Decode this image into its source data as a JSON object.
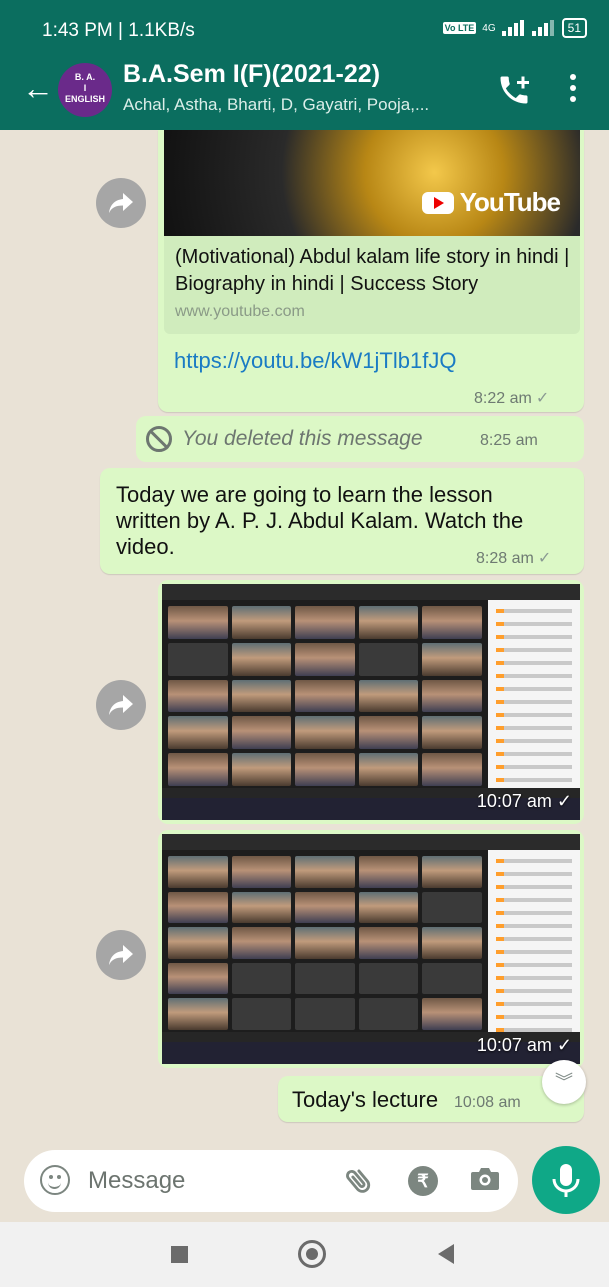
{
  "status_bar": {
    "time": "1:43 PM | 1.1KB/s",
    "network": "4G",
    "lte": "Vo LTE",
    "battery": "51"
  },
  "header": {
    "back_icon": "arrow-left-icon",
    "avatar_lines": [
      "B. A.",
      "I",
      "ENGLISH"
    ],
    "title": "B.A.Sem I(F)(2021-22)",
    "subtitle": "Achal, Astha, Bharti, D, Gayatri, Pooja,...",
    "add_call_icon": "phone-plus-icon",
    "menu_icon": "more-vert-icon"
  },
  "messages": {
    "link_preview": {
      "badge": "YouTube",
      "title": "(Motivational) Abdul kalam life story in hindi | Biography in hindi | Success Story",
      "domain": "www.youtube.com",
      "url": "https://youtu.be/kW1jTlb1fJQ",
      "time": "8:22 am"
    },
    "deleted": {
      "text": "You deleted this message",
      "time": "8:25 am"
    },
    "lesson": {
      "text": "Today we are going to learn the lesson written by A. P. J. Abdul Kalam. Watch the video.",
      "time": "8:28 am"
    },
    "image1": {
      "time": "10:07 am"
    },
    "image2": {
      "time": "10:07 am"
    },
    "lecture": {
      "text": "Today's lecture",
      "time": "10:08 am"
    }
  },
  "composer": {
    "placeholder": "Message",
    "rupee": "₹"
  },
  "colors": {
    "header": "#0b6e5f",
    "outgoing_bubble": "#dcf8c6",
    "chat_bg": "#e9e2d6",
    "mic_button": "#0fa887",
    "link": "#1a7bc4"
  }
}
